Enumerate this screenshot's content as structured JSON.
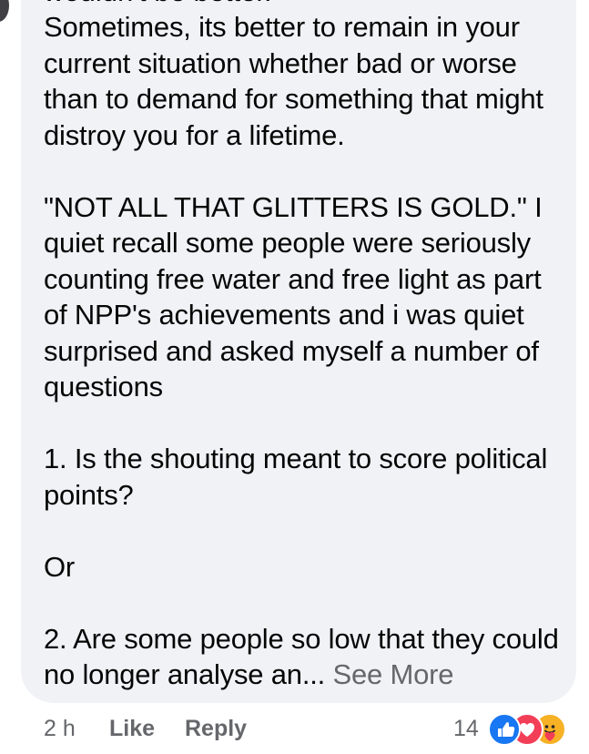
{
  "comment": {
    "clipped_line": "wouldn't be better.",
    "paragraphs": [
      "Sometimes, its better to remain in your current situation whether bad or worse than to demand for something that might distroy you for a lifetime.",
      "\"NOT ALL THAT GLITTERS IS GOLD.\" I quiet recall some people were seriously counting free water and free light as part of NPP's achievements and i was quiet surprised and asked myself a number of questions",
      "1. Is the shouting meant to score political points?",
      "Or",
      "2. Are some people so low that they could no longer analyse an..."
    ],
    "see_more": "See More"
  },
  "footer": {
    "timestamp": "2 h",
    "like_label": "Like",
    "reply_label": "Reply",
    "reaction_count": "14",
    "reactions": [
      "like-icon",
      "love-icon",
      "care-icon"
    ]
  },
  "colors": {
    "bubble_bg": "#f0f2f5",
    "text": "#050505",
    "secondary": "#65676b",
    "like_blue": "#1877f2",
    "love_red": "#f33e58",
    "care_yellow": "#f7b125"
  }
}
